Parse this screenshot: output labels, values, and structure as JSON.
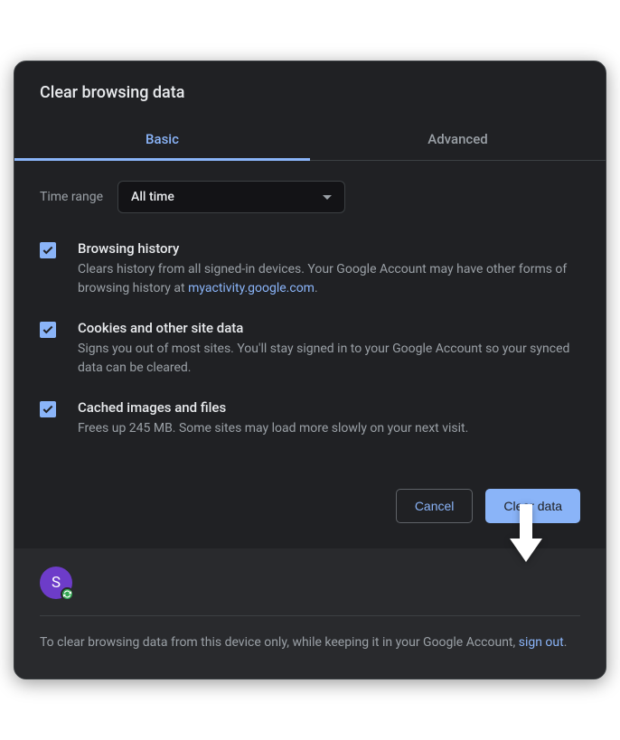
{
  "dialog": {
    "title": "Clear browsing data"
  },
  "tabs": {
    "basic": "Basic",
    "advanced": "Advanced"
  },
  "timeRange": {
    "label": "Time range",
    "value": "All time"
  },
  "options": {
    "browsingHistory": {
      "title": "Browsing history",
      "descPrefix": "Clears history from all signed-in devices. Your Google Account may have other forms of browsing history at ",
      "link": "myactivity.google.com",
      "descSuffix": "."
    },
    "cookies": {
      "title": "Cookies and other site data",
      "desc": "Signs you out of most sites. You'll stay signed in to your Google Account so your synced data can be cleared."
    },
    "cache": {
      "title": "Cached images and files",
      "desc": "Frees up 245 MB. Some sites may load more slowly on your next visit."
    }
  },
  "buttons": {
    "cancel": "Cancel",
    "clearData": "Clear data"
  },
  "footer": {
    "avatarLetter": "S",
    "textPrefix": "To clear browsing data from this device only, while keeping it in your Google Account, ",
    "link": "sign out",
    "textSuffix": "."
  }
}
